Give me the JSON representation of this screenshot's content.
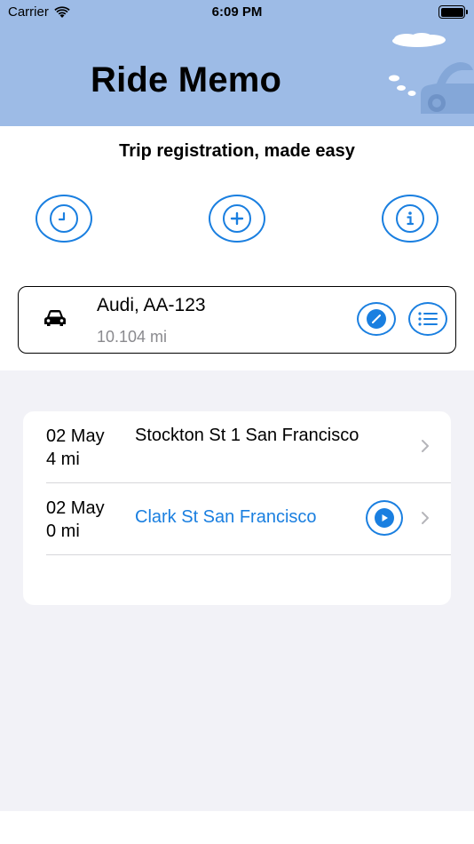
{
  "status_bar": {
    "carrier": "Carrier",
    "time": "6:09 PM"
  },
  "header": {
    "title": "Ride Memo",
    "background_color": "#9dbbe6"
  },
  "tagline": "Trip registration, made easy",
  "action_buttons": [
    {
      "name": "history",
      "icon": "clock-icon"
    },
    {
      "name": "add",
      "icon": "plus-icon"
    },
    {
      "name": "info",
      "icon": "info-icon"
    }
  ],
  "vehicle": {
    "name": "Audi, AA-123",
    "distance": "10.104 mi",
    "icon": "car-icon",
    "edit_icon": "pencil-icon",
    "list_icon": "list-icon"
  },
  "trips": [
    {
      "date": "02 May",
      "distance": "4 mi",
      "address": "Stockton St 1 San Francisco",
      "in_progress": false
    },
    {
      "date": "02 May",
      "distance": "0 mi",
      "address": "Clark St  San Francisco",
      "in_progress": true
    }
  ],
  "accent_color": "#1a7fe0"
}
